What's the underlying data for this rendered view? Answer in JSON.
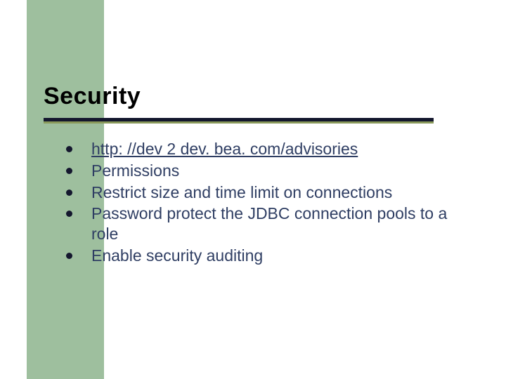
{
  "slide": {
    "title": "Security",
    "bullets": [
      {
        "text": "http: //dev 2 dev. bea. com/advisories",
        "is_link": true
      },
      {
        "text": "Permissions",
        "is_link": false
      },
      {
        "text": "Restrict size and time limit on connections",
        "is_link": false
      },
      {
        "text": "Password protect the JDBC connection pools to a role",
        "is_link": false
      },
      {
        "text": "Enable security auditing",
        "is_link": false
      }
    ]
  }
}
